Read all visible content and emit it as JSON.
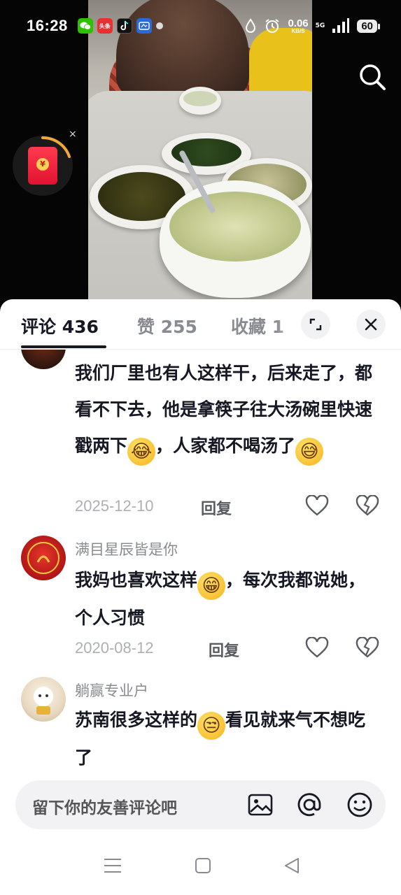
{
  "status_bar": {
    "time": "16:28",
    "notifications": [
      "wechat-icon",
      "toutiao-icon",
      "tiktok-icon",
      "app-icon"
    ],
    "toutiao_label": "头条",
    "net_speed_value": "0.06",
    "net_speed_unit": "KB/S",
    "network_type": "5G",
    "battery": "60"
  },
  "video": {
    "search_icon": "search-icon",
    "redpacket_icon": "redpacket-icon",
    "close_symbol": "×"
  },
  "tabs": {
    "comments": "评论 436",
    "likes": "赞 255",
    "favorites": "收藏 1"
  },
  "comments": [
    {
      "username": "",
      "text_parts": [
        "我们厂里也有人这样干，后来走了，都看不下去，他是拿筷子往大汤碗里快速戳两下",
        "，人家都不喝汤了"
      ],
      "emojis": [
        "laugh-cry-emoji",
        "sweat-grin-emoji"
      ],
      "date": "2025-12-10",
      "reply": "回复"
    },
    {
      "username": "满目星辰皆是你",
      "text_parts": [
        "我妈也喜欢这样",
        "，每次我都说她，个人习惯"
      ],
      "emojis": [
        "grin-emoji"
      ],
      "date": "2020-08-12",
      "reply": "回复"
    },
    {
      "username": "躺赢专业户",
      "text_parts": [
        "苏南很多这样的",
        "看见就来气不想吃了"
      ],
      "emojis": [
        "unamused-emoji"
      ],
      "date": "",
      "reply": ""
    }
  ],
  "input": {
    "placeholder": "留下你的友善评论吧"
  },
  "colors": {
    "panel_bg": "#ffffff",
    "primary_text": "#161823",
    "secondary_text": "#8a8b91",
    "meta_text": "#aeafb3"
  }
}
